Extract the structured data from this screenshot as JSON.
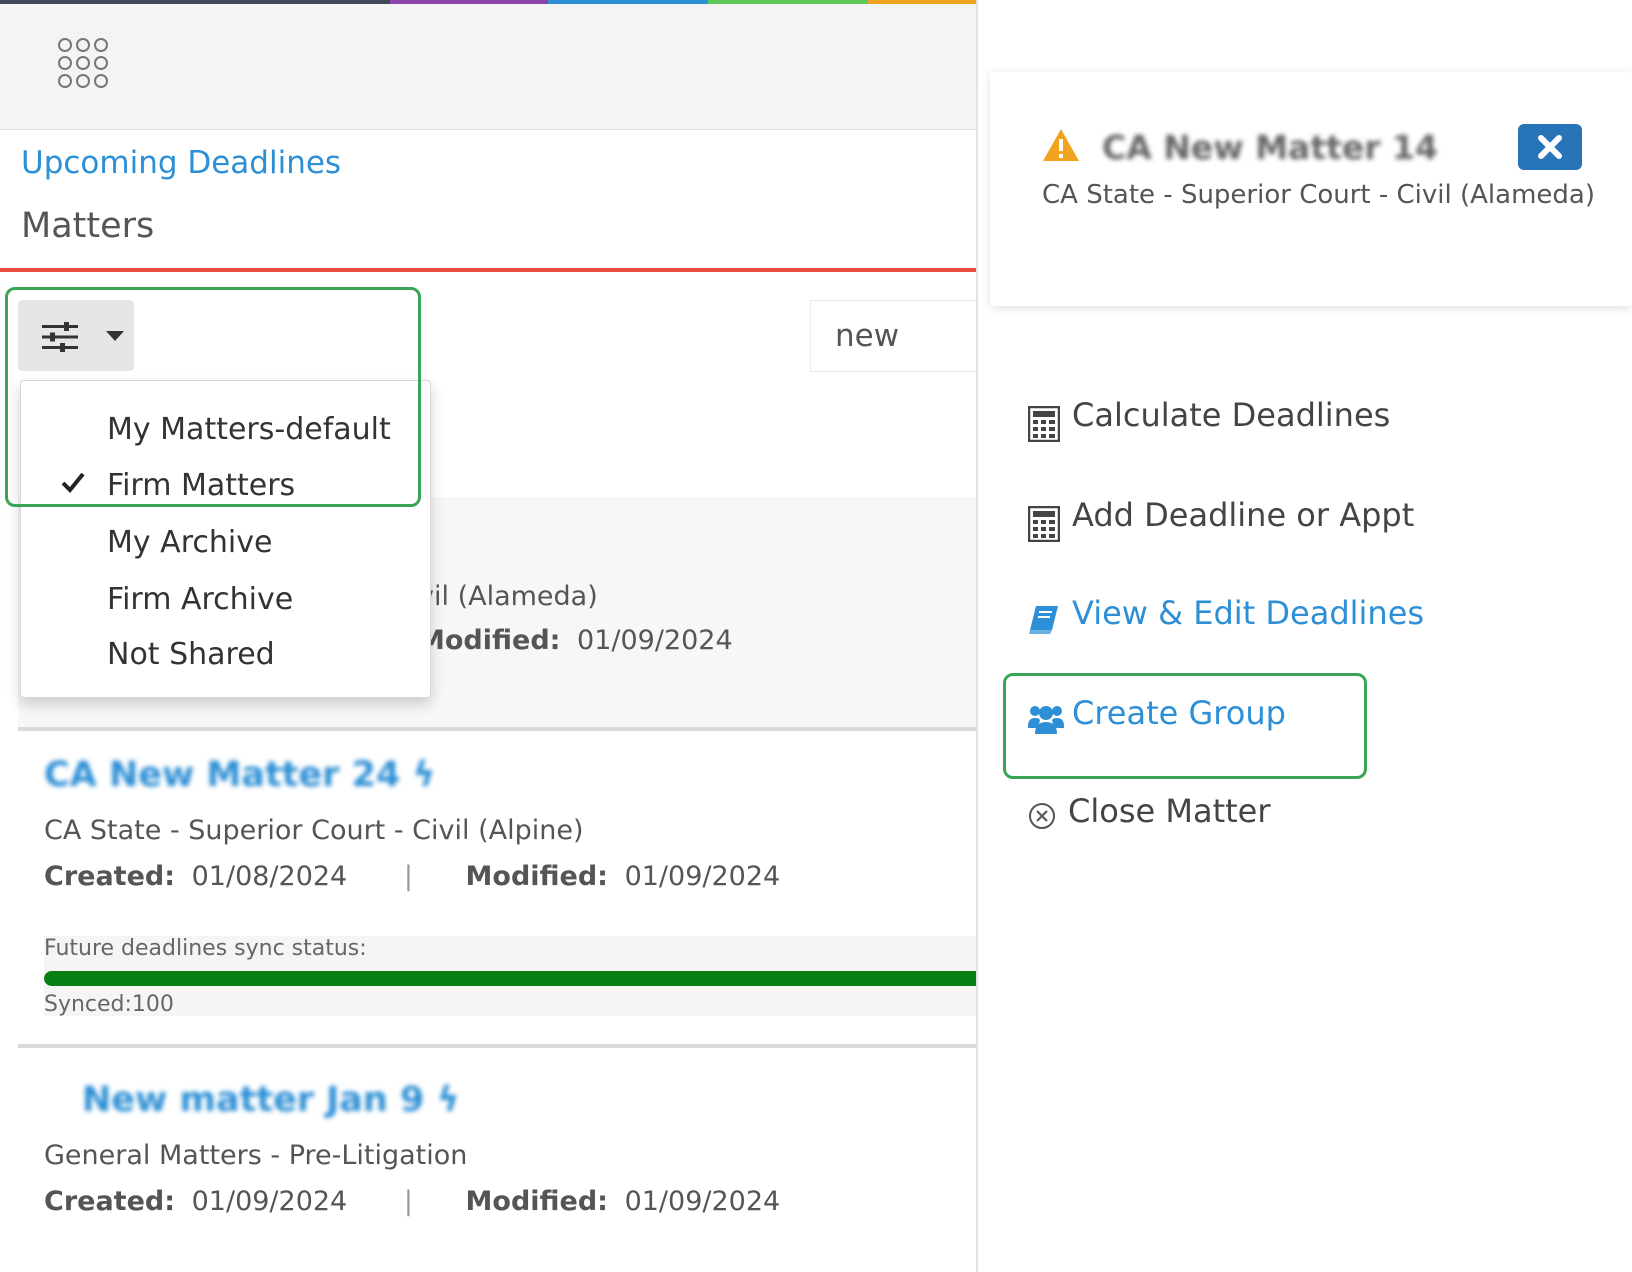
{
  "colors": {
    "link_blue": "#2d8fd5",
    "accent_red": "#e74c3c",
    "highlight_green": "#3aa655",
    "sync_green": "#087f12",
    "close_button_blue": "#2874b8",
    "warning_orange": "#f0a31f",
    "rainbow": [
      "#3f4a5a",
      "#8e44ad",
      "#2d8fd5",
      "#5cc85c",
      "#f0a31f"
    ]
  },
  "nav": {
    "apps_icon": "apps-grid-icon",
    "upcoming_deadlines_link": "Upcoming Deadlines",
    "page_title": "Matters"
  },
  "filter": {
    "icon": "sliders-icon",
    "menu_items": [
      {
        "label": "My Matters-default",
        "checked": false
      },
      {
        "label": "Firm Matters",
        "checked": true
      },
      {
        "label": "My Archive",
        "checked": false
      },
      {
        "label": "Firm Archive",
        "checked": false
      },
      {
        "label": "Not Shared",
        "checked": false
      }
    ]
  },
  "search": {
    "value": "new"
  },
  "matters": [
    {
      "title": "",
      "court_partial": "vil (Alameda)",
      "modified_label_partial": "Modified:",
      "modified": "01/09/2024"
    },
    {
      "title": "CA New Matter 24",
      "court": "CA State - Superior Court - Civil (Alpine)",
      "created_label": "Created:",
      "created": "01/08/2024",
      "modified_label": "Modified:",
      "modified": "01/09/2024",
      "sync": {
        "label": "Future deadlines sync status:",
        "percent": 100,
        "text": "Synced:100"
      }
    },
    {
      "title": "New matter Jan 9",
      "court": "General Matters - Pre-Litigation",
      "created_label": "Created:",
      "created": "01/09/2024",
      "modified_label": "Modified:",
      "modified": "01/09/2024"
    }
  ],
  "detail": {
    "matter_title": "CA New Matter 14",
    "court": "CA State - Superior Court - Civil (Alameda)",
    "close_icon": "close-icon",
    "actions": [
      {
        "label": "Calculate Deadlines",
        "icon": "calculator-icon"
      },
      {
        "label": "Add Deadline or Appt",
        "icon": "calculator-icon"
      },
      {
        "label": "View & Edit Deadlines",
        "icon": "book-icon"
      },
      {
        "label": "Create Group",
        "icon": "users-icon"
      },
      {
        "label": "Close Matter",
        "icon": "circle-x-icon"
      }
    ]
  }
}
